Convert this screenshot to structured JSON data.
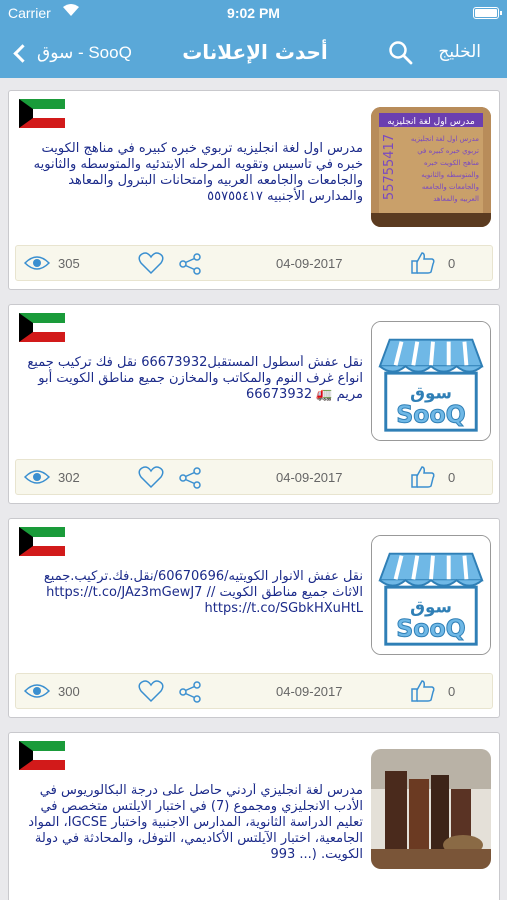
{
  "status": {
    "carrier": "Carrier",
    "time": "9:02 PM"
  },
  "nav": {
    "back_label": "سوق - SooQ",
    "title": "أحدث الإعلانات",
    "region": "الخليج"
  },
  "listings": [
    {
      "description": "مدرس اول لغة انجليزيه تربوي خبره كبيره في مناهج الكويت خبره في تاسيس وتقويه المرحله الابتدئيه والمتوسطه والثانويه والجامعات والجامعه العربيه وامتحانات البترول والمعاهد والمدارس الأجنبيه ٥٥٧٥٥٤١٧",
      "thumb_caption": "مدرس اول لغة انجليزيه",
      "thumb_phone": "55755417",
      "views": "305",
      "date": "04-09-2017",
      "likes": "0"
    },
    {
      "description": "نقل عفش أسطول المستقبل66673932 نقل فك تركيب جميع انواع غرف النوم والمكاتب والمخازن جميع مناطق الكويت أبو مريم 🚛 66673932",
      "thumb_logo": "سوق SooQ",
      "views": "302",
      "date": "04-09-2017",
      "likes": "0"
    },
    {
      "description": "نقل عفش الانوار الكويتيه/60670696/نقل.فك.تركيب.جميع الاثاث جميع مناطق الكويت // https://t.co/JAz3mGewJ7 https://t.co/SGbkHXuHtL",
      "thumb_logo": "سوق SooQ",
      "views": "300",
      "date": "04-09-2017",
      "likes": "0"
    },
    {
      "description": "مدرس لغة انجليزي أردني حاصل على درجة البكالوريوس في الأدب الانجليزي ومجموع (7) في اختبار الايلتس متخصص في تعليم الدراسة الثانوية، المدارس الاجنبية واختبار IGCSE، المواد الجامعية، اختبار الآيلتس الأكاديمي، التوفل، والمحادثة في دولة الكويت. (... 993",
      "views": "",
      "date": "",
      "likes": ""
    }
  ],
  "colors": {
    "nav": "#5aa8d8",
    "text": "#1c2b8a",
    "footer": "#f8f7ec",
    "icon": "#3a8fd0"
  }
}
